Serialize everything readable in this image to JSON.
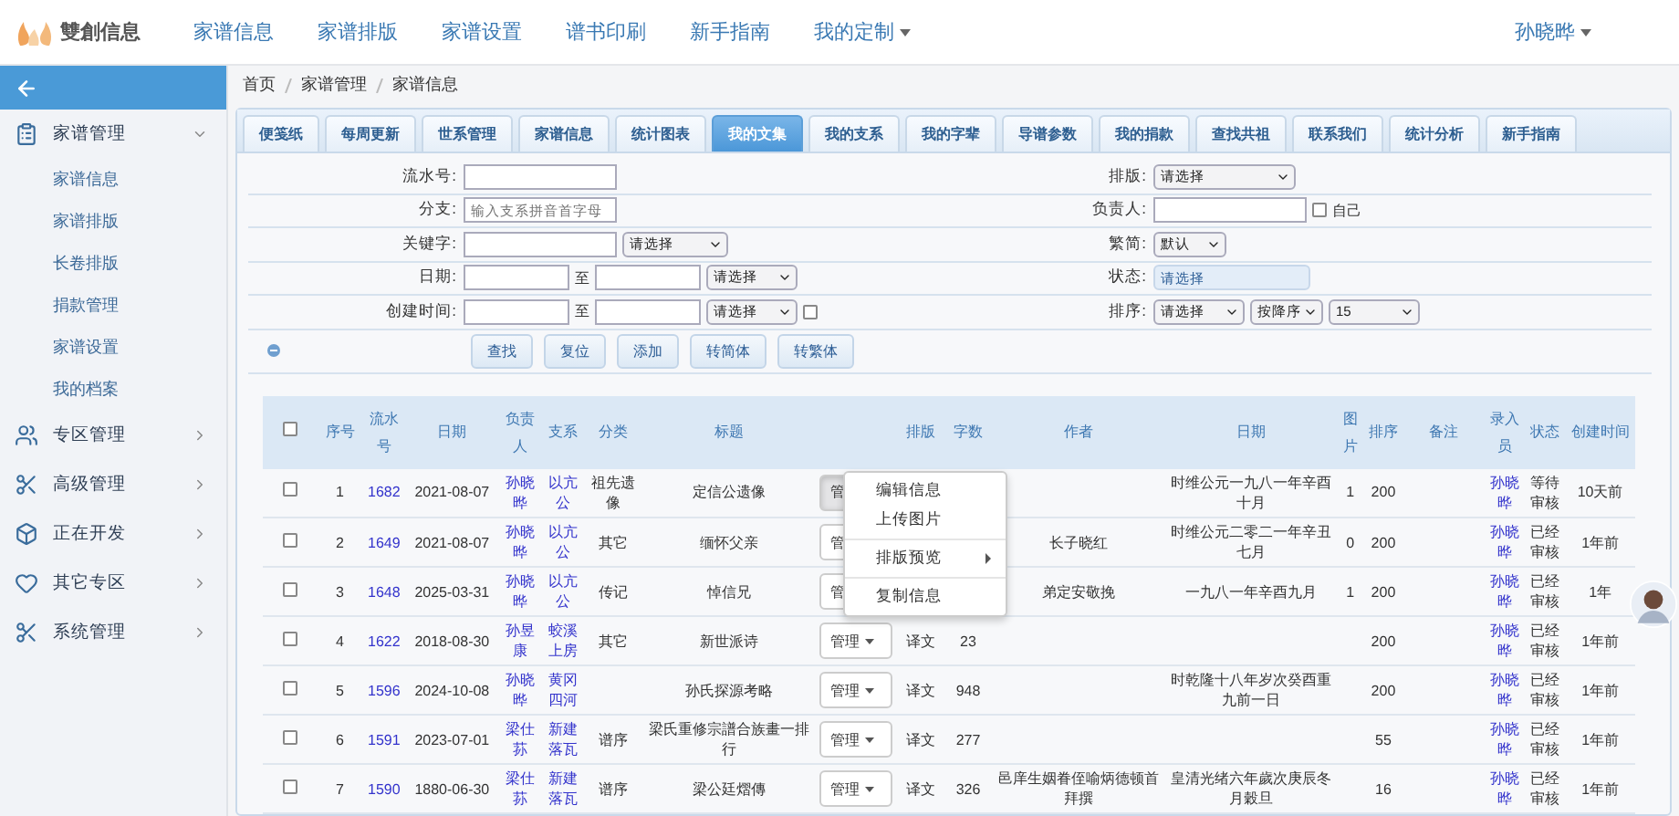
{
  "brand": {
    "name": "雙創信息"
  },
  "nav": [
    {
      "label": "家谱信息",
      "dropdown": false
    },
    {
      "label": "家谱排版",
      "dropdown": false
    },
    {
      "label": "家谱设置",
      "dropdown": false
    },
    {
      "label": "谱书印刷",
      "dropdown": false
    },
    {
      "label": "新手指南",
      "dropdown": false
    },
    {
      "label": "我的定制",
      "dropdown": true
    }
  ],
  "user": {
    "name": "孙晓晔",
    "dropdown": true
  },
  "sidebar": {
    "items": [
      {
        "label": "家谱管理",
        "expanded": true,
        "children": [
          {
            "label": "家谱信息"
          },
          {
            "label": "家谱排版"
          },
          {
            "label": "长卷排版"
          },
          {
            "label": "捐款管理"
          },
          {
            "label": "家谱设置"
          },
          {
            "label": "我的档案"
          }
        ]
      },
      {
        "label": "专区管理",
        "expanded": false
      },
      {
        "label": "高级管理",
        "expanded": false
      },
      {
        "label": "正在开发",
        "expanded": false
      },
      {
        "label": "其它专区",
        "expanded": false
      },
      {
        "label": "系统管理",
        "expanded": false
      }
    ]
  },
  "breadcrumb": [
    "首页",
    "家谱管理",
    "家谱信息"
  ],
  "tabs": [
    {
      "label": "便笺纸",
      "selected": false
    },
    {
      "label": "每周更新",
      "selected": false
    },
    {
      "label": "世系管理",
      "selected": false
    },
    {
      "label": "家谱信息",
      "selected": false
    },
    {
      "label": "统计图表",
      "selected": false
    },
    {
      "label": "我的文集",
      "selected": true
    },
    {
      "label": "我的支系",
      "selected": false
    },
    {
      "label": "我的字辈",
      "selected": false
    },
    {
      "label": "导谱参数",
      "selected": false
    },
    {
      "label": "我的捐款",
      "selected": false
    },
    {
      "label": "查找共祖",
      "selected": false
    },
    {
      "label": "联系我们",
      "selected": false
    },
    {
      "label": "统计分析",
      "selected": false
    },
    {
      "label": "新手指南",
      "selected": false
    }
  ],
  "filters": [
    {
      "left": {
        "label": "流水号:",
        "controls": [
          {
            "kind": "input"
          }
        ]
      },
      "right": {
        "label": "排版:",
        "controls": [
          {
            "kind": "select",
            "value": "请选择"
          }
        ]
      }
    },
    {
      "left": {
        "label": "分支:",
        "controls": [
          {
            "kind": "input",
            "placeholder": "输入支系拼音首字母"
          }
        ]
      },
      "right": {
        "label": "负责人:",
        "controls": [
          {
            "kind": "input"
          },
          {
            "kind": "checkbox",
            "checked": false,
            "label": "自己"
          }
        ]
      }
    },
    {
      "left": {
        "label": "关键字:",
        "controls": [
          {
            "kind": "input"
          },
          {
            "kind": "select",
            "value": "请选择"
          }
        ]
      },
      "right": {
        "label": "繁简:",
        "controls": [
          {
            "kind": "select",
            "value": "默认"
          }
        ]
      }
    },
    {
      "left": {
        "label": "日期:",
        "controls": [
          {
            "kind": "input"
          },
          {
            "kind": "text",
            "text": "至"
          },
          {
            "kind": "input"
          },
          {
            "kind": "select",
            "value": "请选择"
          }
        ]
      },
      "right": {
        "label": "状态:",
        "controls": [
          {
            "kind": "multiselect",
            "value": "请选择"
          }
        ]
      }
    },
    {
      "left": {
        "label": "创建时间:",
        "controls": [
          {
            "kind": "input"
          },
          {
            "kind": "text",
            "text": "至"
          },
          {
            "kind": "input"
          },
          {
            "kind": "select",
            "value": "请选择"
          },
          {
            "kind": "checkbox",
            "checked": false
          }
        ]
      },
      "right": {
        "label": "排序:",
        "controls": [
          {
            "kind": "select",
            "value": "请选择"
          },
          {
            "kind": "select",
            "value": "按降序"
          },
          {
            "kind": "select",
            "value": "15"
          }
        ]
      }
    }
  ],
  "buttons": [
    "查找",
    "复位",
    "添加",
    "转简体",
    "转繁体"
  ],
  "table": {
    "select_all": {
      "checked": false
    },
    "columns": [
      "序号",
      "流水号",
      "日期",
      "负责人",
      "支系",
      "分类",
      "标题",
      "排版",
      "字数",
      "作者",
      "日期",
      "图片",
      "排序",
      "备注",
      "录入员",
      "状态",
      "创建时间"
    ],
    "rows": [
      {
        "checked": false,
        "no": "1",
        "serial": "1682",
        "date": "2021-08-07",
        "owner": "孙晓晔",
        "branch": "以亢公",
        "category": "祖先遗像",
        "title": "定信公遗像",
        "manage": "管",
        "pressed": true,
        "period": "时维公元一九八一年辛酉十月",
        "pics": "1",
        "order": "200",
        "entered_by": "孙晓晔",
        "status": "等待审核",
        "created": "10天前"
      },
      {
        "checked": false,
        "no": "2",
        "serial": "1649",
        "date": "2021-08-07",
        "owner": "孙晓晔",
        "branch": "以亢公",
        "category": "其它",
        "title": "缅怀父亲",
        "manage": "管",
        "pressed": false,
        "author": "长子晓红",
        "period": "时维公元二零二一年辛丑七月",
        "pics": "0",
        "order": "200",
        "entered_by": "孙晓晔",
        "status": "已经审核",
        "created": "1年前"
      },
      {
        "checked": false,
        "no": "3",
        "serial": "1648",
        "date": "2025-03-31",
        "owner": "孙晓晔",
        "branch": "以亢公",
        "category": "传记",
        "title": "悼信兄",
        "manage": "管",
        "pressed": false,
        "author": "弟定安敬挽",
        "period": "一九八一年辛酉九月",
        "pics": "1",
        "order": "200",
        "entered_by": "孙晓晔",
        "status": "已经审核",
        "created": "1年"
      },
      {
        "checked": false,
        "no": "4",
        "serial": "1622",
        "date": "2018-08-30",
        "owner": "孙昱康",
        "branch": "蛟溪上房",
        "category": "其它",
        "title": "新世派诗",
        "manage": "管理",
        "pressed": false,
        "layout": "译文",
        "words": "23",
        "order": "200",
        "entered_by": "孙晓晔",
        "status": "已经审核",
        "created": "1年前"
      },
      {
        "checked": false,
        "no": "5",
        "serial": "1596",
        "date": "2024-10-08",
        "owner": "孙晓晔",
        "branch": "黄冈四河",
        "title": "孙氏探源考略",
        "manage": "管理",
        "pressed": false,
        "layout": "译文",
        "words": "948",
        "period": "时乾隆十八年岁次癸酉重九前一日",
        "order": "200",
        "entered_by": "孙晓晔",
        "status": "已经审核",
        "created": "1年前"
      },
      {
        "checked": false,
        "no": "6",
        "serial": "1591",
        "date": "2023-07-01",
        "owner": "梁仕荪",
        "branch": "新建落瓦",
        "category": "谱序",
        "title": "梁氏重修宗譜合族畫一排行",
        "manage": "管理",
        "pressed": false,
        "layout": "译文",
        "words": "277",
        "order": "55",
        "entered_by": "孙晓晔",
        "status": "已经审核",
        "created": "1年前"
      },
      {
        "checked": false,
        "no": "7",
        "serial": "1590",
        "date": "1880-06-30",
        "owner": "梁仕荪",
        "branch": "新建落瓦",
        "category": "谱序",
        "title": "梁公廷熠傳",
        "manage": "管理",
        "pressed": false,
        "layout": "译文",
        "words": "326",
        "author": "邑庠生姻眷侄喻炳德顿首拜撰",
        "period": "皇清光绪六年歲次庚辰冬月穀旦",
        "order": "16",
        "entered_by": "孙晓晔",
        "status": "已经审核",
        "created": "1年前"
      }
    ]
  },
  "action_menu": {
    "items": [
      {
        "kind": "item",
        "label": "编辑信息"
      },
      {
        "kind": "item",
        "label": "上传图片"
      },
      {
        "kind": "divider"
      },
      {
        "kind": "submenu",
        "label": "排版预览"
      },
      {
        "kind": "divider"
      },
      {
        "kind": "item",
        "label": "复制信息"
      }
    ]
  }
}
